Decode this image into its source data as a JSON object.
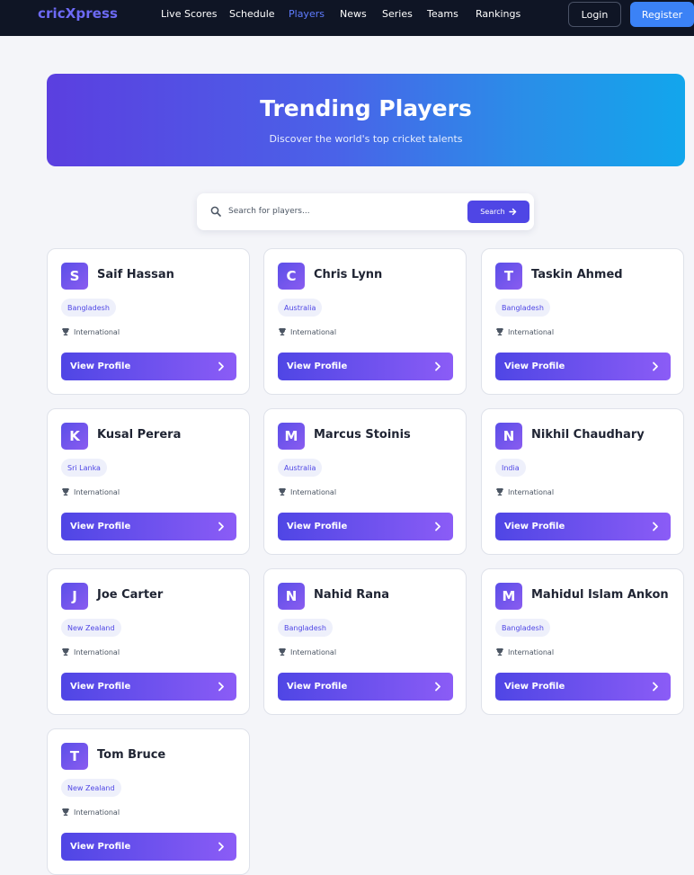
{
  "nav": {
    "logo": "cricXpress",
    "links": [
      "Live Scores",
      "Schedule",
      "Players",
      "News",
      "Series",
      "Teams",
      "Rankings"
    ],
    "active": "Players",
    "login": "Login",
    "register": "Register"
  },
  "hero": {
    "title": "Trending Players",
    "subtitle": "Discover the world's top cricket talents"
  },
  "search": {
    "placeholder": "Search for players...",
    "button": "Search"
  },
  "players": [
    {
      "initial": "S",
      "name": "Saif Hassan",
      "country": "Bangladesh",
      "level": "International",
      "cta": "View Profile"
    },
    {
      "initial": "C",
      "name": "Chris Lynn",
      "country": "Australia",
      "level": "International",
      "cta": "View Profile"
    },
    {
      "initial": "T",
      "name": "Taskin Ahmed",
      "country": "Bangladesh",
      "level": "International",
      "cta": "View Profile"
    },
    {
      "initial": "K",
      "name": "Kusal Perera",
      "country": "Sri Lanka",
      "level": "International",
      "cta": "View Profile"
    },
    {
      "initial": "M",
      "name": "Marcus Stoinis",
      "country": "Australia",
      "level": "International",
      "cta": "View Profile"
    },
    {
      "initial": "N",
      "name": "Nikhil Chaudhary",
      "country": "India",
      "level": "International",
      "cta": "View Profile"
    },
    {
      "initial": "J",
      "name": "Joe Carter",
      "country": "New Zealand",
      "level": "International",
      "cta": "View Profile"
    },
    {
      "initial": "N",
      "name": "Nahid Rana",
      "country": "Bangladesh",
      "level": "International",
      "cta": "View Profile"
    },
    {
      "initial": "M",
      "name": "Mahidul Islam Ankon",
      "country": "Bangladesh",
      "level": "International",
      "cta": "View Profile"
    },
    {
      "initial": "T",
      "name": "Tom Bruce",
      "country": "New Zealand",
      "level": "International",
      "cta": "View Profile"
    }
  ],
  "icons": {
    "search": "search-icon",
    "arrow": "arrow-right-icon",
    "trophy": "trophy-icon",
    "chevron": "chevron-right-icon"
  },
  "colors": {
    "brand": "#6d6af5",
    "accent": "#4f46e5",
    "register": "#3b82f6",
    "nav_bg": "#0f1525"
  }
}
